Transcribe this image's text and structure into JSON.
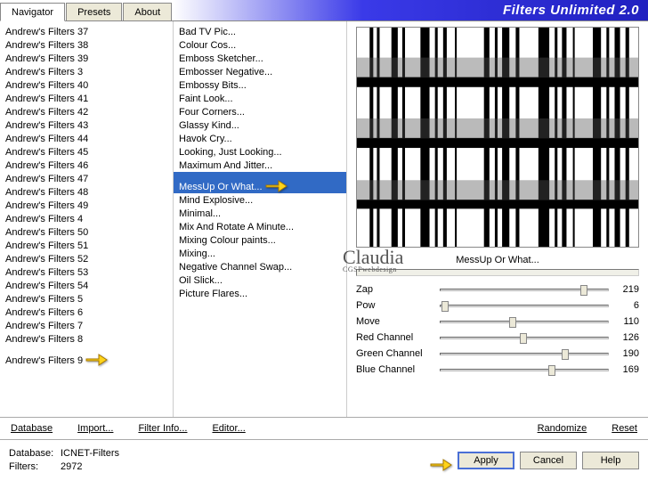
{
  "header": {
    "tabs": [
      "Navigator",
      "Presets",
      "About"
    ],
    "active_tab": 0,
    "title": "Filters Unlimited 2.0"
  },
  "nav_list": [
    "Andrew's Filters 37",
    "Andrew's Filters 38",
    "Andrew's Filters 39",
    "Andrew's Filters 3",
    "Andrew's Filters 40",
    "Andrew's Filters 41",
    "Andrew's Filters 42",
    "Andrew's Filters 43",
    "Andrew's Filters 44",
    "Andrew's Filters 45",
    "Andrew's Filters 46",
    "Andrew's Filters 47",
    "Andrew's Filters 48",
    "Andrew's Filters 49",
    "Andrew's Filters 4",
    "Andrew's Filters 50",
    "Andrew's Filters 51",
    "Andrew's Filters 52",
    "Andrew's Filters 53",
    "Andrew's Filters 54",
    "Andrew's Filters 5",
    "Andrew's Filters 6",
    "Andrew's Filters 7",
    "Andrew's Filters 8",
    "Andrew's Filters 9"
  ],
  "nav_pointer_index": 24,
  "filter_list": [
    "Bad TV Pic...",
    "Colour Cos...",
    "Emboss Sketcher...",
    "Embosser Negative...",
    "Embossy Bits...",
    "Faint Look...",
    "Four Corners...",
    "Glassy Kind...",
    "Havok Cry...",
    "Looking, Just Looking...",
    "Maximum And Jitter...",
    "MessUp Or What...",
    "Mind Explosive...",
    "Minimal...",
    "Mix And Rotate A Minute...",
    "Mixing Colour paints...",
    "Mixing...",
    "Negative Channel Swap...",
    "Oil Slick...",
    "Picture Flares..."
  ],
  "filter_selected_index": 11,
  "preview_title": "MessUp Or What...",
  "sliders": [
    {
      "label": "Zap",
      "value": 219,
      "max": 255
    },
    {
      "label": "Pow",
      "value": 6,
      "max": 255
    },
    {
      "label": "Move",
      "value": 110,
      "max": 255
    },
    {
      "label": "Red Channel",
      "value": 126,
      "max": 255
    },
    {
      "label": "Green Channel",
      "value": 190,
      "max": 255
    },
    {
      "label": "Blue Channel",
      "value": 169,
      "max": 255
    }
  ],
  "links": {
    "database": "Database",
    "import": "Import...",
    "filter_info": "Filter Info...",
    "editor": "Editor...",
    "randomize": "Randomize",
    "reset": "Reset"
  },
  "footer": {
    "db_label": "Database:",
    "db_value": "ICNET-Filters",
    "filters_label": "Filters:",
    "filters_value": "2972",
    "apply": "Apply",
    "cancel": "Cancel",
    "help": "Help"
  },
  "signature": "Claudia",
  "signature_sub": "CGSPwebdesign"
}
